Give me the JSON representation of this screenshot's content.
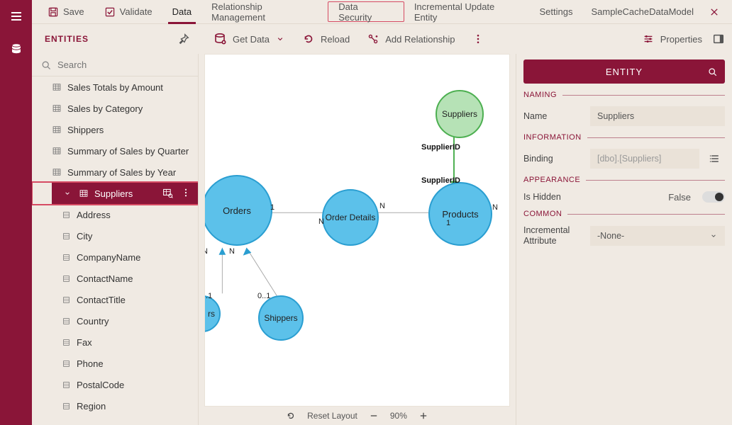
{
  "menubar": {
    "save": "Save",
    "validate": "Validate",
    "data": "Data",
    "relationship": "Relationship Management",
    "security": "Data Security",
    "incremental": "Incremental Update Entity",
    "settings": "Settings",
    "model": "SampleCacheDataModel"
  },
  "toolbar": {
    "entities": "ENTITIES",
    "getData": "Get Data",
    "reload": "Reload",
    "addRel": "Add Relationship",
    "properties": "Properties"
  },
  "search": {
    "placeholder": "Search"
  },
  "tree": {
    "items": [
      "Sales Totals by Amount",
      "Sales by Category",
      "Shippers",
      "Summary of Sales by Quarter",
      "Summary of Sales by Year"
    ],
    "selected": "Suppliers",
    "children": [
      "Address",
      "City",
      "CompanyName",
      "ContactName",
      "ContactTitle",
      "Country",
      "Fax",
      "Phone",
      "PostalCode",
      "Region"
    ]
  },
  "diagram": {
    "nodes": {
      "orders": "Orders",
      "orderDetails": "Order Details",
      "products": "Products",
      "suppliers": "Suppliers",
      "shippers": "Shippers",
      "customers": "rs"
    },
    "labels": {
      "supplierId": "SupplierID"
    },
    "card": {
      "one": "1",
      "n": "N",
      "zeroOne": "0..1",
      "dotOne": "..1"
    }
  },
  "status": {
    "reset": "Reset Layout",
    "zoom": "90%"
  },
  "props": {
    "entity": "ENTITY",
    "naming": "NAMING",
    "nameLabel": "Name",
    "nameValue": "Suppliers",
    "information": "INFORMATION",
    "bindingLabel": "Binding",
    "bindingValue": "[dbo].[Suppliers]",
    "appearance": "APPEARANCE",
    "hiddenLabel": "Is Hidden",
    "hiddenValue": "False",
    "common": "COMMON",
    "incLabel": "Incremental Attribute",
    "incValue": "-None-"
  }
}
